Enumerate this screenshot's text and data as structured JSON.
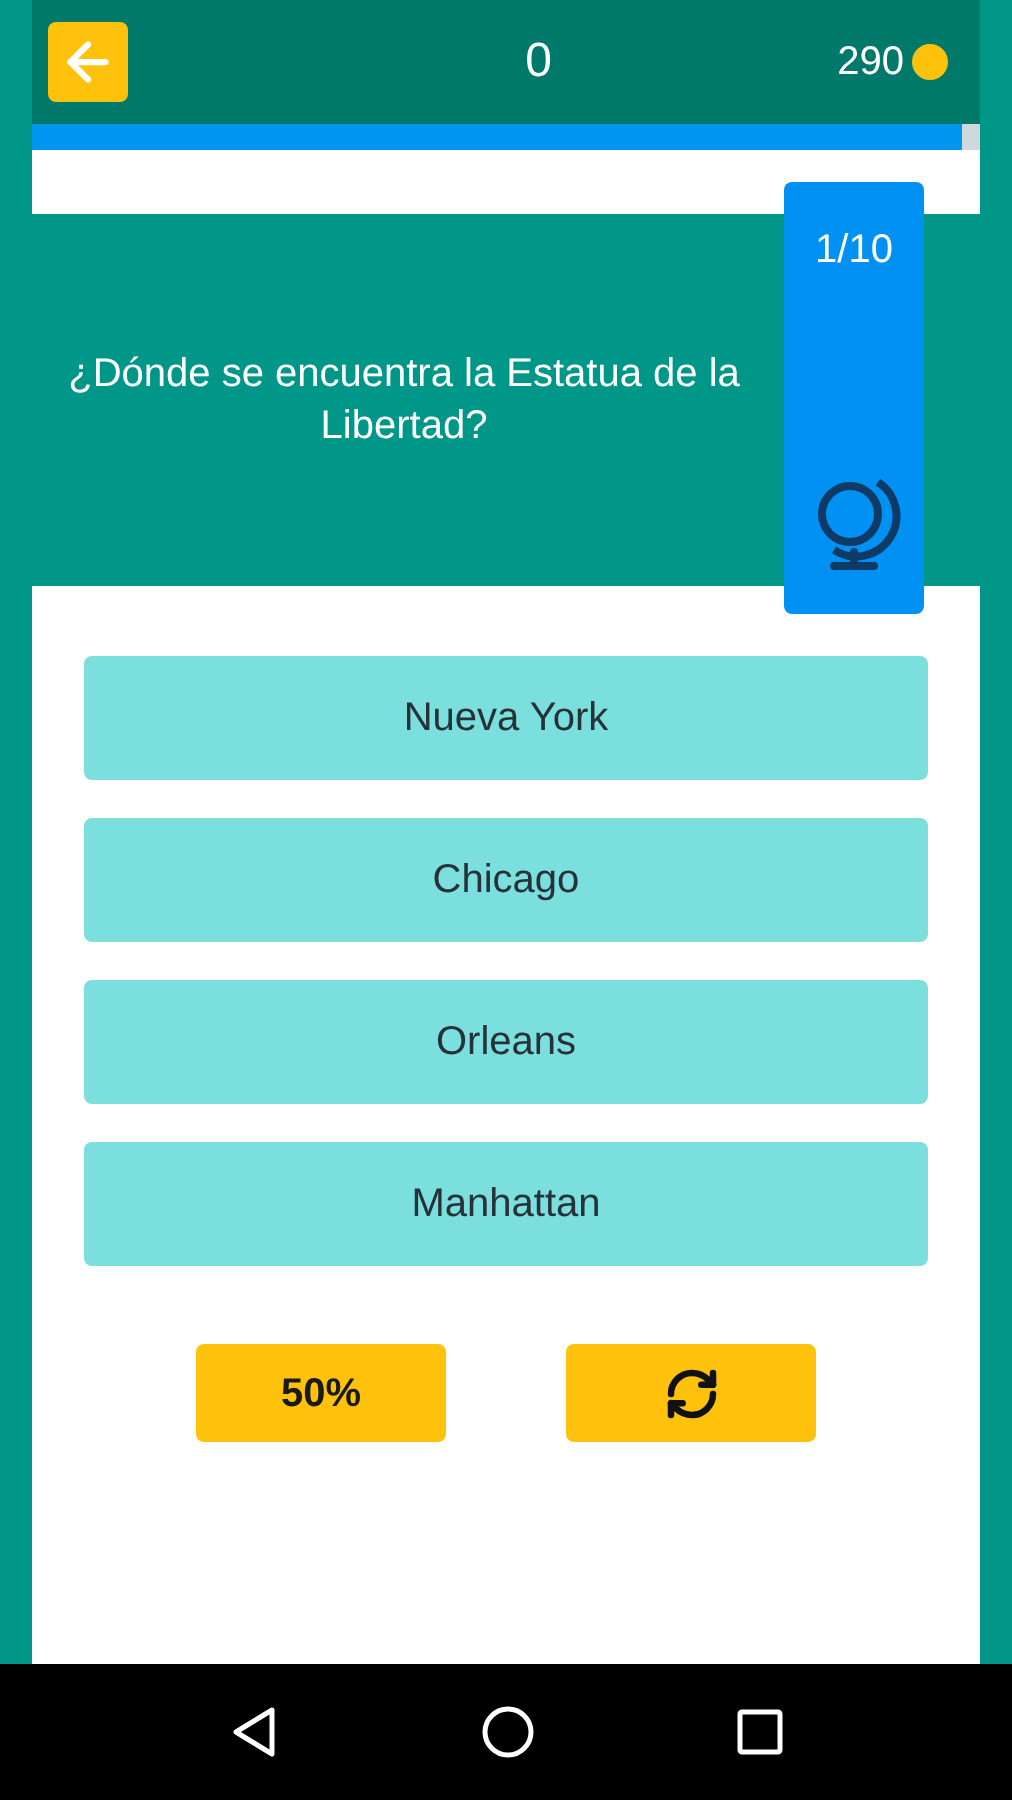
{
  "header": {
    "score": "0",
    "coins": "290"
  },
  "progress": {
    "level": 0.98
  },
  "question": {
    "text": "¿Dónde se encuentra la Estatua de la Libertad?",
    "counter": "1/10"
  },
  "answers": [
    "Nueva York",
    "Chicago",
    "Orleans",
    "Manhattan"
  ],
  "helpers": [
    {
      "kind": "text",
      "label": "50%"
    },
    {
      "kind": "refresh"
    }
  ]
}
